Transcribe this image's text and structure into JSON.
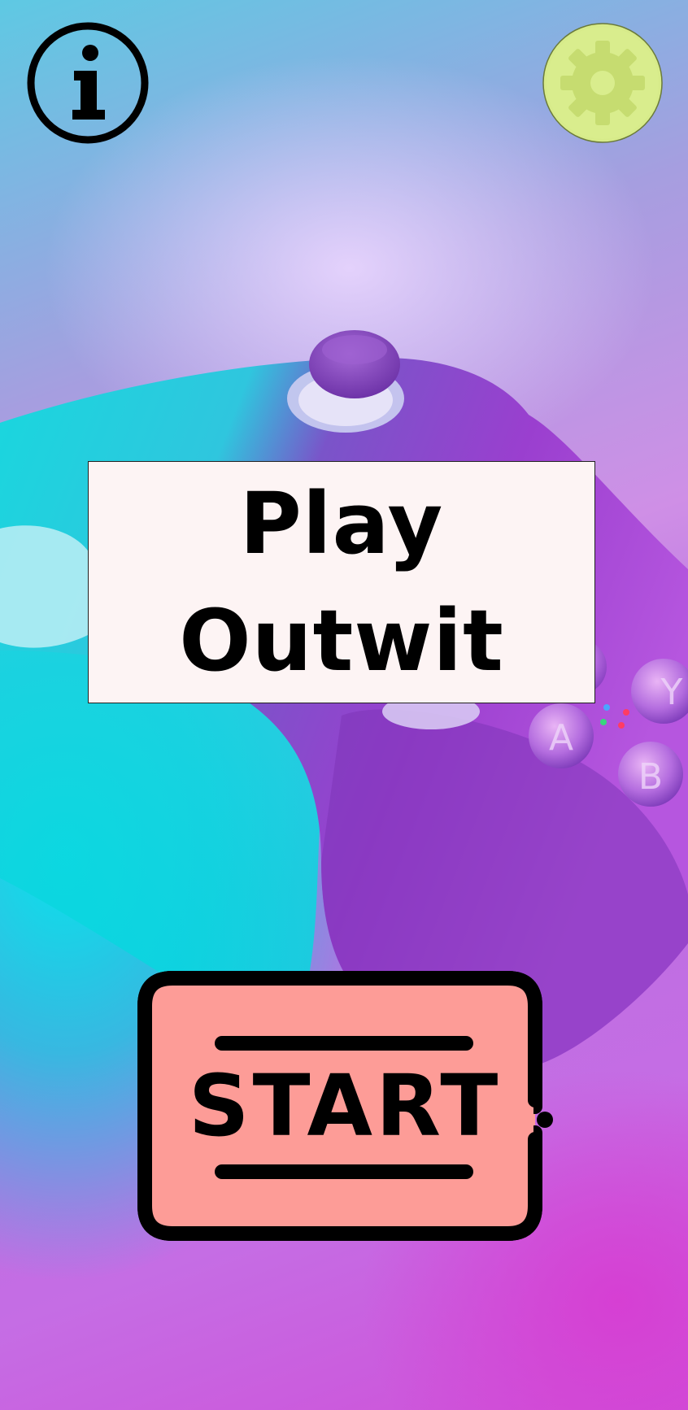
{
  "screen": {
    "name": "main-menu"
  },
  "background": {
    "description_icon": "game-controller-icon",
    "colors": {
      "cyan": "#00dde3",
      "purple": "#a85fd6",
      "magenta": "#d04ad6",
      "controller_body": "#8c42c9"
    }
  },
  "info_button": {
    "icon": "info-icon",
    "color": "#000000"
  },
  "settings_button": {
    "icon": "gear-icon",
    "fill": "#d9ec8c",
    "gear_color": "#c5dd6d"
  },
  "title": {
    "line1": "Play",
    "line2": "Outwit",
    "card_color": "#fdf4f4"
  },
  "start_button": {
    "label": "START",
    "fill": "#fd9c97",
    "outline": "#000000"
  }
}
